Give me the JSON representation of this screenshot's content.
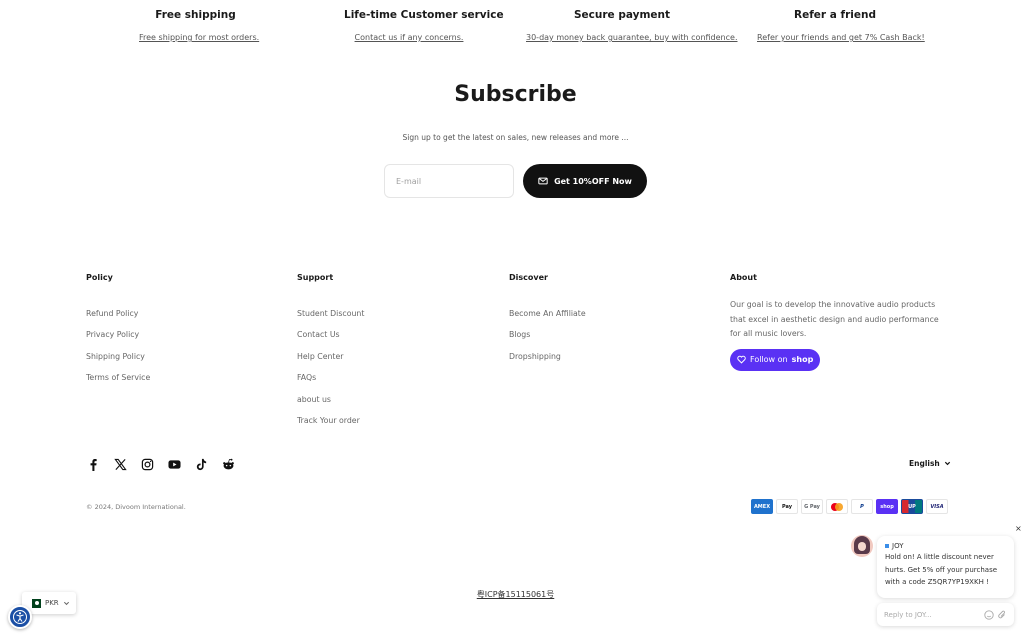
{
  "benefits": [
    {
      "title": "Free shipping",
      "link": "Free shipping for most orders."
    },
    {
      "title": "Life-time Customer service",
      "link": "Contact us if any concerns."
    },
    {
      "title": "Secure payment",
      "link": "30-day money back guarantee, buy with confidence."
    },
    {
      "title": "Refer a friend",
      "link": "Refer your friends and get 7% Cash Back!"
    }
  ],
  "subscribe": {
    "title": "Subscribe",
    "text": "Sign up to get the latest on sales, new releases and more ...",
    "email_placeholder": "E-mail",
    "button_label": "Get 10%OFF Now"
  },
  "footer": {
    "policy": {
      "heading": "Policy",
      "items": [
        "Refund Policy",
        "Privacy Policy",
        "Shipping Policy",
        "Terms of Service"
      ]
    },
    "support": {
      "heading": "Support",
      "items": [
        "Student Discount",
        "Contact Us",
        "Help Center",
        "FAQs",
        "about us",
        "Track Your order"
      ]
    },
    "discover": {
      "heading": "Discover",
      "items": [
        "Become An Affiliate",
        "Blogs",
        "Dropshipping"
      ]
    },
    "about": {
      "heading": "About",
      "text": "Our goal is to develop the innovative audio products that excel in aesthetic design and audio performance for all music lovers.",
      "follow_label": "Follow on",
      "shop_label": "shop"
    }
  },
  "social_icons": [
    "facebook-icon",
    "x-icon",
    "instagram-icon",
    "youtube-icon",
    "tiktok-icon",
    "reddit-icon"
  ],
  "language": "English",
  "copyright": "© 2024, Divoom International.",
  "payments": [
    {
      "name": "American Express",
      "label": "AMEX",
      "color": "#1f72cd"
    },
    {
      "name": "Apple Pay",
      "label": "Pay",
      "color": "#ffffff"
    },
    {
      "name": "Google Pay",
      "label": "G Pay",
      "color": "#ffffff"
    },
    {
      "name": "Mastercard",
      "label": "",
      "color": "#ffffff"
    },
    {
      "name": "PayPal",
      "label": "P",
      "color": "#ffffff"
    },
    {
      "name": "Shop Pay",
      "label": "shop",
      "color": "#5a31f4"
    },
    {
      "name": "UnionPay",
      "label": "UP",
      "color": "#d7282f"
    },
    {
      "name": "Visa",
      "label": "VISA",
      "color": "#ffffff"
    }
  ],
  "icp": "粤ICP备15115061号",
  "currency": "PKR",
  "chat": {
    "agent_name": "JOY",
    "message": "Hold on! A little discount never hurts. Get 5% off your purchase with a code Z5QR7YP19XKH !",
    "input_placeholder": "Reply to JOY..."
  },
  "colors": {
    "accent_dark": "#111111",
    "shop_purple": "#5a31f4",
    "accessibility_blue": "#1b4fa5"
  }
}
